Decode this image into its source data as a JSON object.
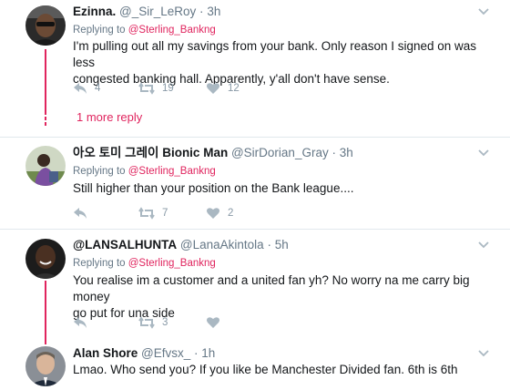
{
  "tweets": [
    {
      "name": "Ezinna.",
      "handle": "@_Sir_LeRoy",
      "dot": "·",
      "time": "3h",
      "reply_prefix": "Replying to",
      "reply_user": "@Sterling_Bankng",
      "text_lines": [
        "I'm pulling out all my savings from your  bank. Only reason I signed on was less",
        "congested banking hall. Apparently, y'all don't have sense."
      ],
      "reply_count": "4",
      "retweet_count": "19",
      "like_count": "12",
      "more_replies": "1 more reply"
    },
    {
      "name": "아오 토미 그레이 Bionic Man",
      "handle": "@SirDorian_Gray",
      "dot": "·",
      "time": "3h",
      "reply_prefix": "Replying to",
      "reply_user": "@Sterling_Bankng",
      "text_lines": [
        "Still higher than your position on the Bank league...."
      ],
      "reply_count": "",
      "retweet_count": "7",
      "like_count": "2"
    },
    {
      "name": "@LANSALHUNTA",
      "handle": "@LanaAkintola",
      "dot": "·",
      "time": "5h",
      "reply_prefix": "Replying to",
      "reply_user": "@Sterling_Bankng",
      "text_lines": [
        "You realise im a customer and a united fan yh? No worry na me carry big money",
        "go put for una side"
      ],
      "reply_count": "",
      "retweet_count": "3",
      "like_count": ""
    },
    {
      "name": "Alan Shore",
      "handle": "@Efvsx_",
      "dot": "·",
      "time": "1h",
      "text_lines": [
        "Lmao. Who send you? If you like be Manchester Divided fan. 6th is 6th"
      ]
    }
  ],
  "icons": {
    "reply": "reply-icon",
    "retweet": "retweet-icon",
    "like": "heart-icon",
    "more": "chevron-down-icon"
  },
  "colors": {
    "accent": "#e0245e",
    "muted": "#657786",
    "icon": "#aab8c2",
    "text": "#14171a",
    "separator": "#e1e8ed"
  }
}
